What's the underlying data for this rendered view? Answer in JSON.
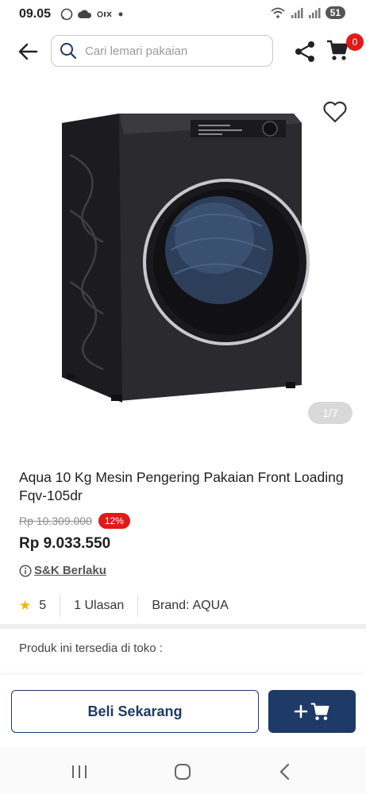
{
  "status_bar": {
    "time": "09.05",
    "battery": "51"
  },
  "header": {
    "search_placeholder": "Cari lemari pakaian",
    "cart_count": "0"
  },
  "gallery": {
    "page_indicator": "1/7"
  },
  "product": {
    "title": "Aqua 10 Kg Mesin Pengering Pakaian Front Loading Fqv-105dr",
    "old_price": "Rp 10.309.000",
    "discount": "12%",
    "price": "Rp 9.033.550",
    "terms": "S&K Berlaku",
    "rating": "5",
    "reviews": "1 Ulasan",
    "brand_label": "Brand:",
    "brand": "AQUA"
  },
  "store_availability": "Produk ini tersedia di toko :",
  "actions": {
    "buy_now": "Beli Sekarang"
  },
  "colors": {
    "primary": "#1e3a66",
    "badge_red": "#e11919",
    "star": "#f5b400"
  }
}
